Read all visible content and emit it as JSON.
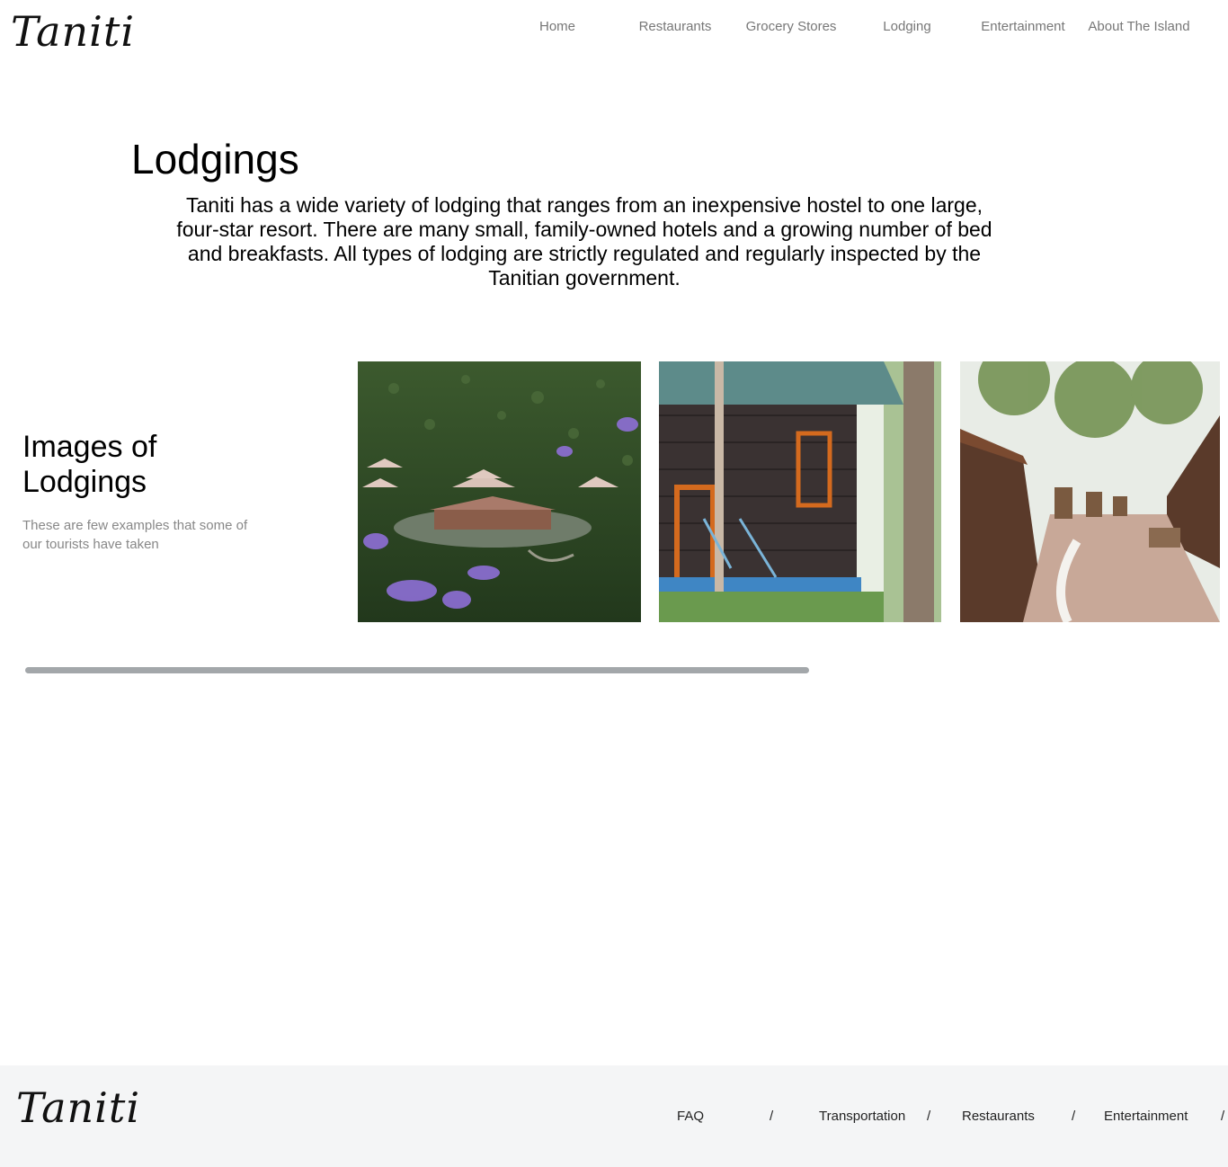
{
  "header": {
    "logo_text": "Taniti",
    "nav": [
      {
        "label": "Home"
      },
      {
        "label": "Restaurants"
      },
      {
        "label": "Grocery Stores"
      },
      {
        "label": "Lodging"
      },
      {
        "label": "Entertainment"
      },
      {
        "label": "About The Island"
      }
    ]
  },
  "main": {
    "title": "Lodgings",
    "intro": "Taniti has a wide variety of lodging that ranges from an inexpensive hostel to one large, four-star resort. There are many small, family-owned hotels and a growing number of bed and breakfasts. All types of lodging are strictly regulated and regularly inspected by the Tanitian government."
  },
  "gallery": {
    "heading": "Images of Lodgings",
    "subtitle": "These are few examples that some of our tourists have taken",
    "photos": [
      {
        "icon": "tent-resort-photo"
      },
      {
        "icon": "wooden-cabin-photo"
      },
      {
        "icon": "courtyard-walkway-photo"
      }
    ]
  },
  "footer": {
    "logo_text": "Taniti",
    "links": [
      {
        "label": "FAQ"
      },
      {
        "label": "Transportation"
      },
      {
        "label": "Restaurants"
      },
      {
        "label": "Entertainment"
      }
    ],
    "separator": "/"
  }
}
